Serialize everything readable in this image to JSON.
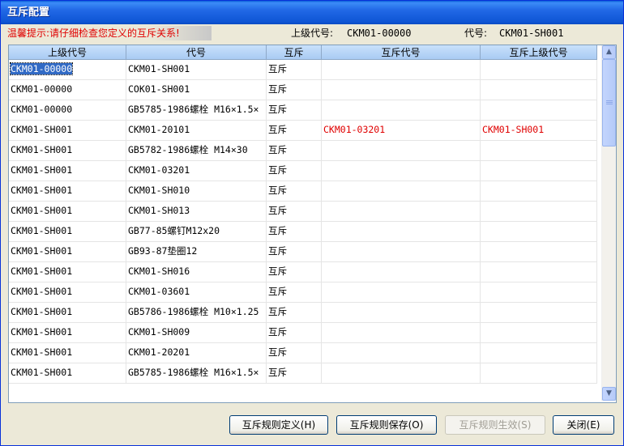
{
  "window": {
    "title": "互斥配置"
  },
  "info": {
    "tip": "温馨提示:请仔细检查您定义的互斥关系!",
    "parent_code_label": "上级代号:",
    "parent_code_value": "CKM01-00000",
    "code_label": "代号:",
    "code_value": "CKM01-SH001"
  },
  "grid": {
    "columns": [
      "上级代号",
      "代号",
      "互斥",
      "互斥代号",
      "互斥上级代号"
    ],
    "rows": [
      [
        "CKM01-00000",
        "CKM01-SH001",
        "互斥",
        "",
        ""
      ],
      [
        "CKM01-00000",
        "COK01-SH001",
        "互斥",
        "",
        ""
      ],
      [
        "CKM01-00000",
        "GB5785-1986螺栓 M16×1.5×",
        "互斥",
        "",
        ""
      ],
      [
        "CKM01-SH001",
        "CKM01-20101",
        "互斥",
        "CKM01-03201",
        "CKM01-SH001"
      ],
      [
        "CKM01-SH001",
        "GB5782-1986螺栓 M14×30",
        "互斥",
        "",
        ""
      ],
      [
        "CKM01-SH001",
        "CKM01-03201",
        "互斥",
        "",
        ""
      ],
      [
        "CKM01-SH001",
        "CKM01-SH010",
        "互斥",
        "",
        ""
      ],
      [
        "CKM01-SH001",
        "CKM01-SH013",
        "互斥",
        "",
        ""
      ],
      [
        "CKM01-SH001",
        "GB77-85螺钉M12x20",
        "互斥",
        "",
        ""
      ],
      [
        "CKM01-SH001",
        "GB93-87垫圈12",
        "互斥",
        "",
        ""
      ],
      [
        "CKM01-SH001",
        "CKM01-SH016",
        "互斥",
        "",
        ""
      ],
      [
        "CKM01-SH001",
        "CKM01-03601",
        "互斥",
        "",
        ""
      ],
      [
        "CKM01-SH001",
        "GB5786-1986螺栓 M10×1.25",
        "互斥",
        "",
        ""
      ],
      [
        "CKM01-SH001",
        "CKM01-SH009",
        "互斥",
        "",
        ""
      ],
      [
        "CKM01-SH001",
        "CKM01-20201",
        "互斥",
        "",
        ""
      ],
      [
        "CKM01-SH001",
        "GB5785-1986螺栓 M16×1.5×",
        "互斥",
        "",
        ""
      ]
    ],
    "selected_row": 0,
    "highlight_color": "#E00000"
  },
  "buttons": {
    "define": "互斥规则定义(H)",
    "save": "互斥规则保存(O)",
    "apply": "互斥规则生效(S)",
    "close": "关闭(E)"
  },
  "icons": {
    "scroll_up": "chevron-up-icon",
    "scroll_down": "chevron-down-icon"
  }
}
